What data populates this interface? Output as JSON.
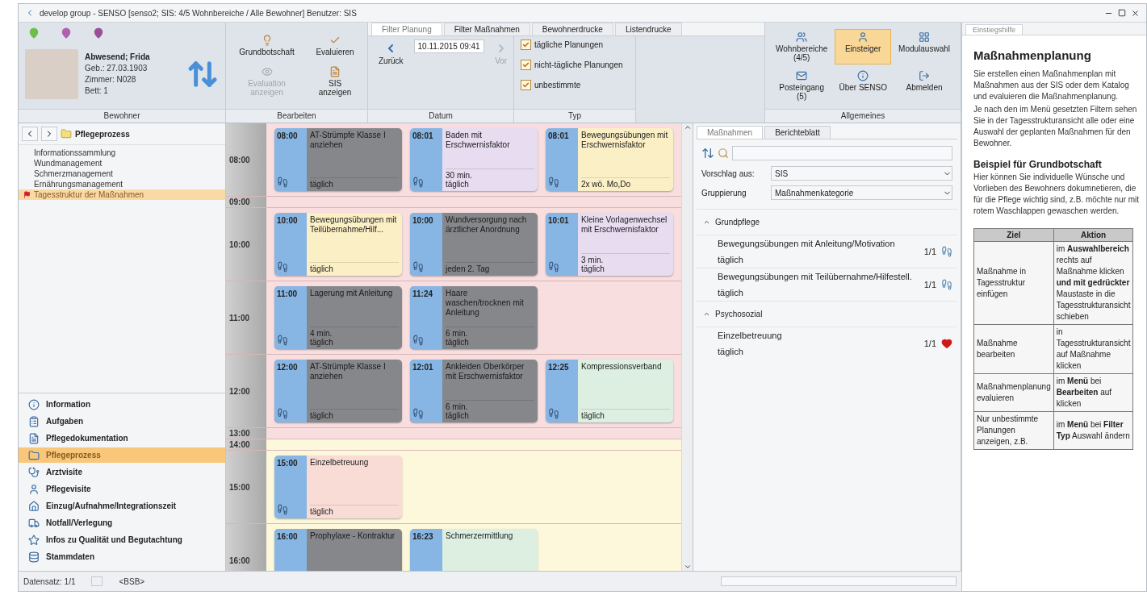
{
  "window": {
    "title": "develop group - SENSO [senso2; SIS: 4/5 Wohnbereiche / Alle Bewohner] Benutzer: SIS"
  },
  "ribbon": {
    "tabs": [
      {
        "label": "Filter Planung",
        "selected": true
      },
      {
        "label": "Filter Maßnahmen",
        "selected": false
      },
      {
        "label": "Bewohnerdrucke",
        "selected": false
      },
      {
        "label": "Listendrucke",
        "selected": false
      }
    ],
    "resident": {
      "label": "Bewohner",
      "name": "Abwesend; Frida",
      "lines": [
        "Geb.: 27.03.1903",
        "Zimmer: N028",
        "Bett: 1"
      ]
    },
    "edit": {
      "label": "Bearbeiten",
      "buttons": [
        {
          "label": "Grundbotschaft",
          "disabled": false
        },
        {
          "label": "Evaluieren",
          "disabled": false
        },
        {
          "label": "Evaluation anzeigen",
          "disabled": true
        },
        {
          "label": "SIS anzeigen",
          "disabled": false
        }
      ]
    },
    "date": {
      "label": "Datum",
      "back": {
        "label": "Zurück",
        "disabled": false
      },
      "value": "10.11.2015 09:41",
      "forward": {
        "label": "Vor",
        "disabled": true
      }
    },
    "type": {
      "label": "Typ",
      "options": [
        {
          "label": "tägliche Planungen",
          "checked": true
        },
        {
          "label": "nicht-tägliche Planungen",
          "checked": true
        },
        {
          "label": "unbestimmte",
          "checked": true
        }
      ]
    },
    "general": {
      "label": "Allgemeines",
      "buttons": [
        {
          "label": "Wohnbereiche (4/5)",
          "selected": false
        },
        {
          "label": "Einsteiger",
          "selected": true
        },
        {
          "label": "Modulauswahl",
          "selected": false
        },
        {
          "label": "Posteingang (5)",
          "selected": false
        },
        {
          "label": "Über SENSO",
          "selected": false
        },
        {
          "label": "Abmelden",
          "selected": false
        }
      ]
    }
  },
  "navigator": {
    "title": "Pflegeprozess",
    "tree": [
      {
        "label": "Informationssammlung",
        "selected": false
      },
      {
        "label": "Wundmanagement",
        "selected": false
      },
      {
        "label": "Schmerzmanagement",
        "selected": false
      },
      {
        "label": "Ernährungsmanagement",
        "selected": false
      },
      {
        "label": "Tagesstruktur der Maßnahmen",
        "selected": true
      }
    ],
    "menu": [
      {
        "label": "Information",
        "selected": false
      },
      {
        "label": "Aufgaben",
        "selected": false
      },
      {
        "label": "Pflegedokumentation",
        "selected": false
      },
      {
        "label": "Pflegeprozess",
        "selected": true
      },
      {
        "label": "Arztvisite",
        "selected": false
      },
      {
        "label": "Pflegevisite",
        "selected": false
      },
      {
        "label": "Einzug/Aufnahme/Integrationszeit",
        "selected": false
      },
      {
        "label": "Notfall/Verlegung",
        "selected": false
      },
      {
        "label": "Infos zu Qualität und Begutachtung",
        "selected": false
      },
      {
        "label": "Stammdaten",
        "selected": false
      }
    ]
  },
  "schedule": {
    "rows": [
      {
        "time": "08:00",
        "color": "#f8dede",
        "cards": [
          {
            "time": "08:00",
            "title": "AT-Strümpfe Klasse I anziehen",
            "frequency": "täglich",
            "color": "#86878b"
          },
          {
            "time": "08:01",
            "title": "Baden mit Erschwernisfaktor",
            "duration": "30 min.",
            "frequency": "täglich",
            "color": "#e7dcf0"
          },
          {
            "time": "08:01",
            "title": "Bewegungsübungen mit Erschwernisfaktor",
            "frequency": "2x wö. Mo,Do",
            "color": "#fbefc6"
          }
        ]
      },
      {
        "time": "09:00",
        "color": "#f8dede",
        "cards": []
      },
      {
        "time": "10:00",
        "color": "#f8dede",
        "cards": [
          {
            "time": "10:00",
            "title": "Bewegungsübungen mit Teilübernahme/Hilf...",
            "frequency": "täglich",
            "color": "#fbefc6"
          },
          {
            "time": "10:00",
            "title": "Wundversorgung nach ärztlicher Anordnung",
            "frequency": "jeden 2. Tag",
            "color": "#86878b"
          },
          {
            "time": "10:01",
            "title": "Kleine Vorlagenwechsel mit Erschwernisfaktor",
            "duration": "3 min.",
            "frequency": "täglich",
            "color": "#e7dcf0"
          }
        ]
      },
      {
        "time": "11:00",
        "color": "#f8dede",
        "cards": [
          {
            "time": "11:00",
            "title": "Lagerung mit Anleitung",
            "duration": "4 min.",
            "frequency": "täglich",
            "color": "#86878b"
          },
          {
            "time": "11:24",
            "title": "Haare waschen/trocknen mit Anleitung",
            "duration": "6 min.",
            "frequency": "täglich",
            "color": "#86878b"
          }
        ]
      },
      {
        "time": "12:00",
        "color": "#f8dede",
        "cards": [
          {
            "time": "12:00",
            "title": "AT-Strümpfe Klasse I anziehen",
            "frequency": "täglich",
            "color": "#86878b"
          },
          {
            "time": "12:01",
            "title": "Ankleiden Oberkörper mit Erschwernisfaktor",
            "duration": "6 min.",
            "frequency": "täglich",
            "color": "#86878b"
          },
          {
            "time": "12:25",
            "title": "Kompressionsverband",
            "frequency": "täglich",
            "color": "#dcefe1"
          }
        ]
      },
      {
        "time": "13:00",
        "color": "#f8dede",
        "cards": []
      },
      {
        "time": "14:00",
        "color": "#fdf8dc",
        "cards": []
      },
      {
        "time": "15:00",
        "color": "#fdf8dc",
        "cards": [
          {
            "time": "15:00",
            "title": "Einzelbetreuung",
            "frequency": "täglich",
            "color": "#f9dcd6"
          }
        ]
      },
      {
        "time": "16:00",
        "color": "#fdf8dc",
        "cards": [
          {
            "time": "16:00",
            "title": "Prophylaxe - Kontraktur",
            "color": "#86878b"
          },
          {
            "time": "16:23",
            "title": "Schmerzermittlung",
            "color": "#dcefe1"
          }
        ]
      }
    ]
  },
  "measures": {
    "tabs": [
      {
        "label": "Maßnahmen",
        "selected": true
      },
      {
        "label": "Berichteblatt",
        "selected": false
      }
    ],
    "suggest": {
      "label": "Vorschlag aus:",
      "value": "SIS"
    },
    "grouping": {
      "label": "Gruppierung",
      "value": "Maßnahmenkategorie"
    },
    "groups": [
      {
        "title": "Grundpflege",
        "expanded": true,
        "items": [
          {
            "title": "Bewegungsübungen mit Anleitung/Motivation",
            "frequency": "täglich",
            "count": "1/1"
          },
          {
            "title": "Bewegungsübungen mit Teilübernahme/Hilfestell.",
            "frequency": "täglich",
            "count": "1/1"
          }
        ]
      },
      {
        "title": "Psychosozial",
        "expanded": true,
        "items": [
          {
            "title": "Einzelbetreuung",
            "frequency": "täglich",
            "count": "1/1"
          }
        ]
      }
    ]
  },
  "help": {
    "tab": "Einstiegshilfe",
    "title": "Maßnahmenplanung",
    "paragraphs": [
      "Sie erstellen einen Maßnahmenplan mit Maßnahmen aus der SIS oder dem Katalog und evaluieren die Maßnahmenplanung.",
      "Je nach den im Menü gesetzten Filtern sehen Sie in der Tagesstrukturansicht alle oder eine Auswahl der geplanten Maßnahmen für den Bewohner."
    ],
    "subtitle": "Beispiel für Grundbotschaft",
    "body": "Hier können Sie individuelle Wünsche und Vorlieben des Bewohners dokumnetieren, die für die Pflege wichtig sind, z.B. möchte nur mit rotem Waschlappen gewaschen werden.",
    "table": {
      "columns": [
        "Ziel",
        "Aktion"
      ],
      "rows": [
        [
          "Maßnahme in Tagesstruktur einfügen",
          "im **Auswahlbereich** rechts auf Maßnahme klicken **und mit gedrückter** Maustaste in die Tagesstrukturansicht schieben"
        ],
        [
          "Maßnahme bearbeiten",
          "in Tagesstrukturansicht auf Maßnahme klicken"
        ],
        [
          "Maßnahmenplanung evaluieren",
          "im **Menü** bei **Bearbeiten** auf klicken"
        ],
        [
          "Nur unbestimmte Planungen anzeigen, z.B.",
          "im **Menü** bei **Filter Typ** Auswahl ändern"
        ]
      ]
    }
  },
  "status_bar": {
    "record": "Datensatz: 1/1",
    "field": "<BSB>"
  }
}
